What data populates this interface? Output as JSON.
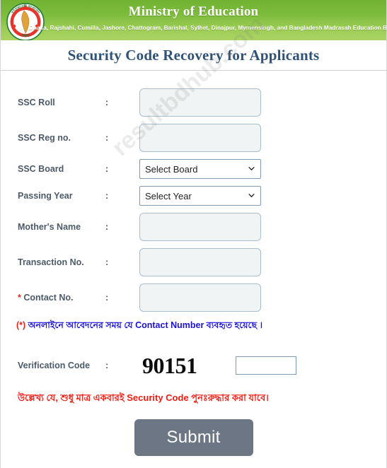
{
  "header": {
    "ministry_title": "Ministry of Education",
    "boards_subtitle": "Dhaka, Rajshahi, Cumilla, Jashore, Chattogram, Barishal, Sylhet, Dinajpur, Mymensingh, and Bangladesh Madrasah Education Board",
    "logo_alt": "bangladesh-government-emblem",
    "banner_green_top": "#72b233",
    "banner_green_bottom": "#aad363"
  },
  "page_title": "Security Code Recovery for Applicants",
  "watermark": "resultbdhub.com",
  "form": {
    "colon": ":",
    "fields": [
      {
        "label": "SSC Roll",
        "required_mark": "",
        "type": "text",
        "value": "",
        "placeholder": ""
      },
      {
        "label": "SSC Reg no.",
        "required_mark": "",
        "type": "text",
        "value": "",
        "placeholder": ""
      },
      {
        "label": "SSC Board",
        "required_mark": "",
        "type": "select",
        "value": "Select Board"
      },
      {
        "label": "Passing Year",
        "required_mark": "",
        "type": "select",
        "value": "Select Year"
      },
      {
        "label": "Mother's Name",
        "required_mark": "",
        "type": "text",
        "value": "",
        "placeholder": ""
      },
      {
        "label": "Transaction No.",
        "required_mark": "",
        "type": "text",
        "value": "",
        "placeholder": ""
      },
      {
        "label": "Contact No.",
        "required_mark": "*",
        "type": "text",
        "value": "",
        "placeholder": ""
      }
    ]
  },
  "notes": {
    "contact_note_paren": "(*)",
    "contact_note_text": " অনলাইনে আবেদনের সময় যে Contact Number ব্যবহৃত হয়েছে ।",
    "contact_note_color": "#1b12d8",
    "warning_text": "উল্লেখ্য যে, শুধু মাত্র একবারই Security Code পুনঃরুদ্ধার করা যাবে।",
    "warning_color": "#f21b12"
  },
  "verification": {
    "label": "Verification Code",
    "colon": ":",
    "captcha_code": "90151",
    "input_value": "",
    "input_placeholder": ""
  },
  "submit": {
    "label": "Submit",
    "color": "#6c7684"
  }
}
